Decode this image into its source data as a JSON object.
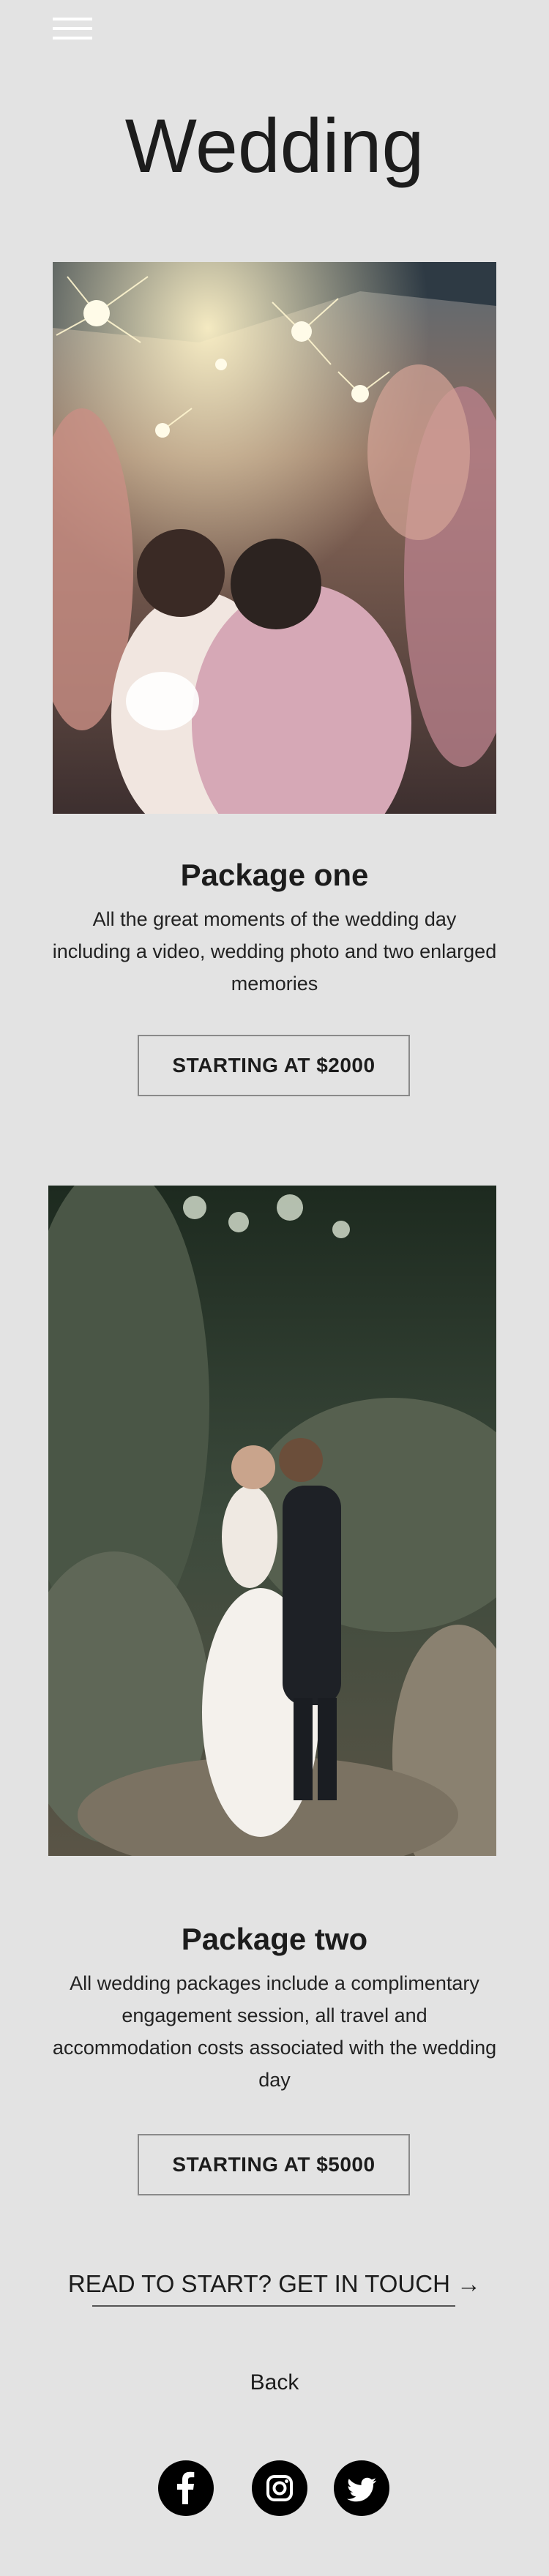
{
  "header": {
    "menu_icon": "hamburger-menu-icon",
    "title": "Wedding"
  },
  "packages": [
    {
      "image": "couple-kissing-under-sparklers-photo",
      "title": "Package one",
      "description": "All the great moments of the wedding day including a video, wedding photo and two enlarged memories",
      "button_label": "STARTING AT $2000"
    },
    {
      "image": "couple-embracing-among-rocks-photo",
      "title": "Package two",
      "description": "All wedding packages include a complimentary engagement session, all travel and accommodation costs associated with the wedding day",
      "button_label": "STARTING AT $5000"
    }
  ],
  "cta": {
    "label": "READ TO START? GET IN TOUCH →"
  },
  "back": {
    "label": "Back"
  },
  "social": [
    {
      "name": "facebook-icon"
    },
    {
      "name": "instagram-icon"
    },
    {
      "name": "twitter-icon"
    }
  ],
  "colors": {
    "background": "#e3e3e3",
    "text": "#1c1c1c",
    "button_border": "#8a8a8a",
    "icon_bg": "#000000"
  }
}
